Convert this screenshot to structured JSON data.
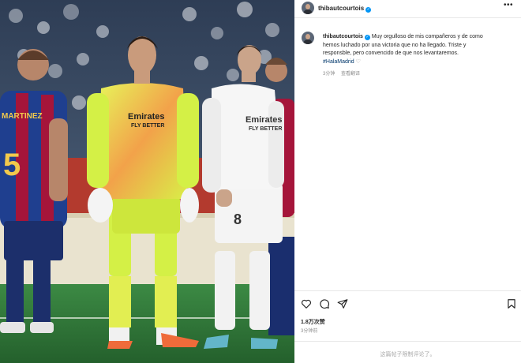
{
  "post": {
    "username": "thibautcourtois",
    "verified_glyph": "✓",
    "more_icon": "more-horizontal-icon",
    "caption": {
      "line1": "Muy orgulloso de mis compañeros y de como",
      "line2": "hemos luchado por una victoria que no ha llegado. Triste y",
      "line3": "responsble, pero convencido de que nos levantaremos.",
      "hashtag": "#HalaMadrid",
      "heart_glyph": "♡",
      "time": "3分钟",
      "see_translation": "查看翻译"
    },
    "actions": {
      "like_icon": "heart-icon",
      "comment_icon": "comment-icon",
      "share_icon": "send-icon",
      "save_icon": "bookmark-icon"
    },
    "likes": "1.8万次赞",
    "timestamp": "3分钟前",
    "comments_notice": "这篇帖子限制评论了。"
  },
  "photo": {
    "players": [
      {
        "name": "left-player",
        "number": "5",
        "shirt_text": "MARTINEZ"
      },
      {
        "name": "goalkeeper",
        "sponsor": "Emirates",
        "sponsor_sub": "FLY BETTER"
      },
      {
        "name": "center-player",
        "number": "8",
        "sponsor": "Emirates",
        "sponsor_sub": "FLY BETTER"
      }
    ]
  },
  "colors": {
    "verified": "#0095f6",
    "hashtag": "#00376b",
    "muted": "#8e8e8e",
    "goalkeeper_kit": "#d4f046",
    "barca_blue": "#1f3f8f",
    "barca_red": "#a5153a",
    "pitch": "#2f7a3a"
  }
}
